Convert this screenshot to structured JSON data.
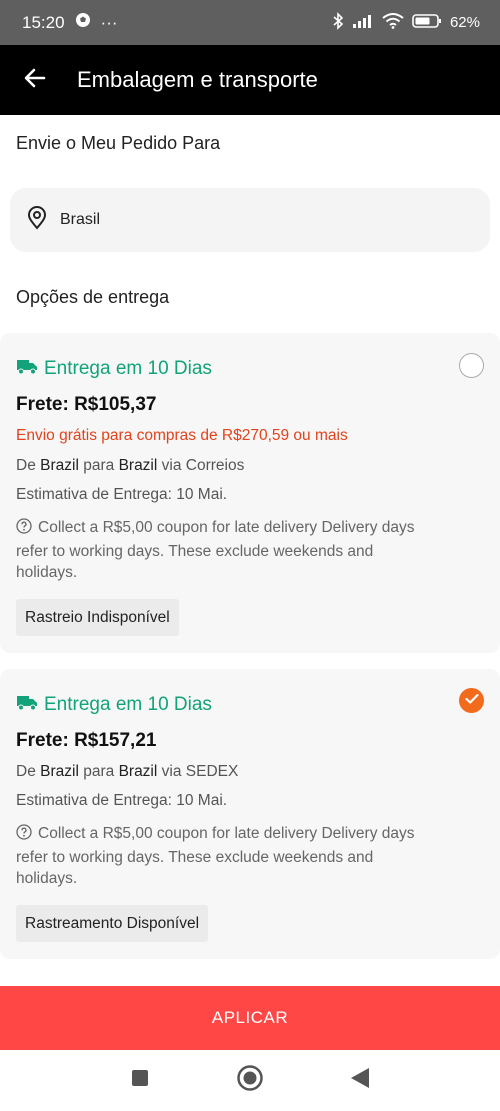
{
  "status_bar": {
    "time": "15:20",
    "more": "···",
    "battery": "62%"
  },
  "header": {
    "title": "Embalagem e transporte"
  },
  "ship_to": {
    "title": "Envie o Meu Pedido Para",
    "country": "Brasil"
  },
  "delivery_options_title": "Opções de entrega",
  "options": [
    {
      "title": "Entrega em 10 Dias",
      "price": "Frete: R$105,37",
      "promo": "Envio grátis para compras de R$270,59 ou mais",
      "route_prefix": "De",
      "route_from": "Brazil",
      "route_mid": "para",
      "route_to": "Brazil",
      "route_via": "via Correios",
      "estimate": "Estimativa de Entrega: 10 Mai.",
      "note": "Collect a R$5,00 coupon for late delivery Delivery days refer to working days. These exclude weekends and holidays.",
      "tracking": "Rastreio Indisponível",
      "selected": false
    },
    {
      "title": "Entrega em 10 Dias",
      "price": "Frete: R$157,21",
      "route_prefix": "De",
      "route_from": "Brazil",
      "route_mid": "para",
      "route_to": "Brazil",
      "route_via": "via SEDEX",
      "estimate": "Estimativa de Entrega: 10 Mai.",
      "note": "Collect a R$5,00 coupon for late delivery Delivery days refer to working days. These exclude weekends and holidays.",
      "tracking": "Rastreamento Disponível",
      "selected": true
    }
  ],
  "apply_label": "APLICAR",
  "colors": {
    "accent_green": "#12a37a",
    "promo_red": "#e2431c",
    "apply_red": "#ff4746",
    "selected_orange": "#f26a1b"
  }
}
